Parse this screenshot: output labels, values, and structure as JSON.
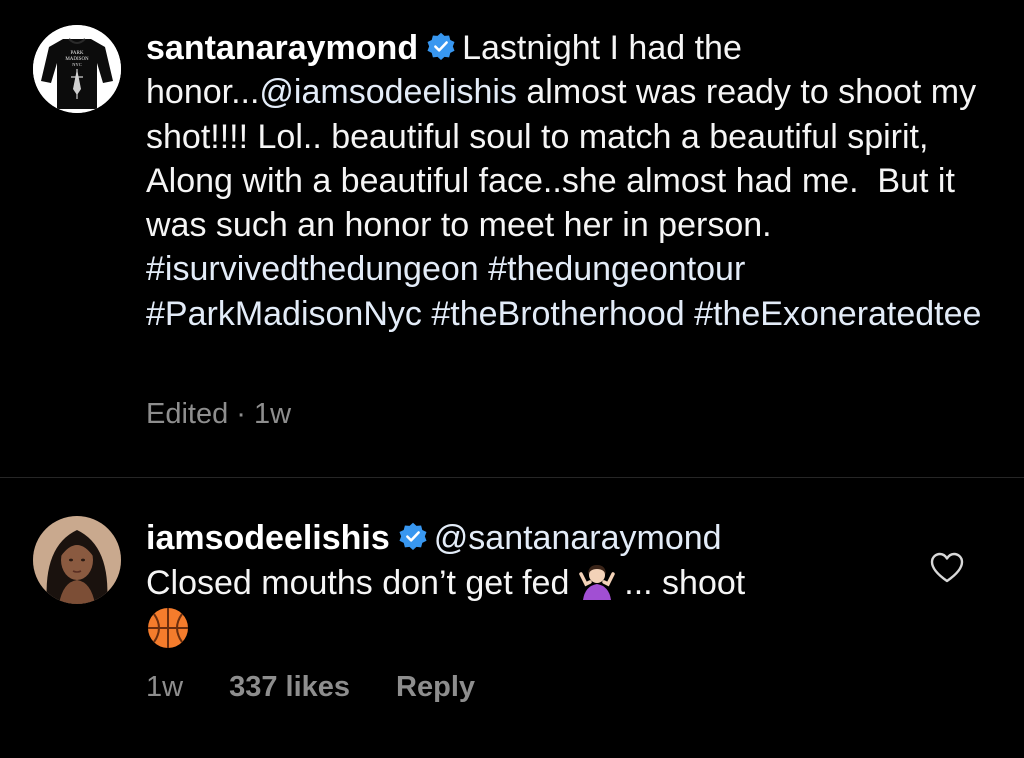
{
  "post": {
    "username": "santanaraymond",
    "verified": true,
    "avatar_text": [
      "PARK",
      "MADISON",
      "NYC"
    ],
    "caption_part1": "Lastnight I had the honor...",
    "caption_mention": "@iamsodeelishis",
    "caption_part2": " almost was ready to shoot my shot!!!! Lol.. beautiful soul to match a beautiful spirit, Along with a beautiful face..she almost had me.  But it was such an honor to meet her in person. ",
    "hashtags": [
      "#isurvivedthedungeon",
      "#thedungeontour",
      "#ParkMadisonNyc",
      "#theBrotherhood",
      "#theExoneratedtee"
    ],
    "meta": "Edited · 1w"
  },
  "comment": {
    "username": "iamsodeelishis",
    "verified": true,
    "mention": "@santanaraymond",
    "text_before_emoji": "Closed mouths don’t get fed ",
    "emoji_1": "woman-shrugging-emoji",
    "text_after_emoji": " ... shoot",
    "emoji_2": "basketball-emoji",
    "time": "1w",
    "likes": "337 likes",
    "reply_label": "Reply"
  },
  "colors": {
    "background": "#000000",
    "text": "#f5f5f5",
    "muted": "#8e8e8e",
    "link": "#e3ecf8",
    "verified_blue": "#3897f0",
    "divider": "#262626"
  }
}
